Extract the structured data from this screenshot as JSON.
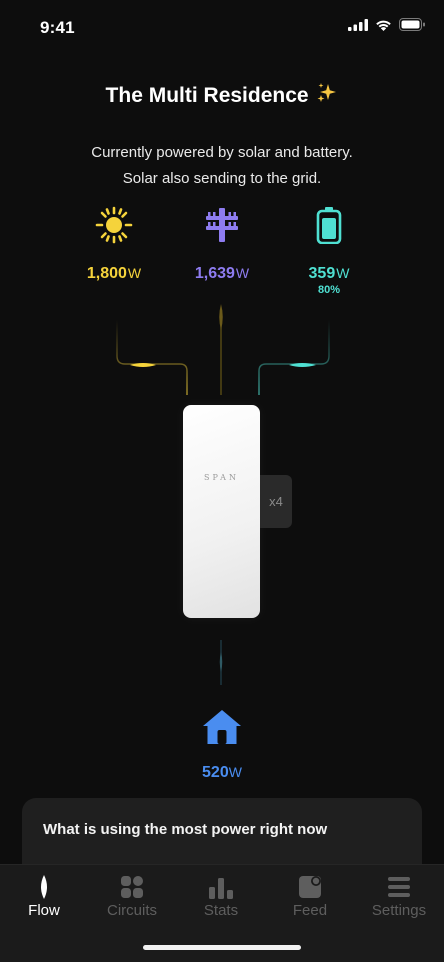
{
  "status_bar": {
    "time": "9:41"
  },
  "header": {
    "title": "The Multi Residence"
  },
  "status_text": {
    "line1": "Currently powered by solar and battery.",
    "line2": "Solar also sending to the grid."
  },
  "sources": {
    "solar": {
      "value": "1,800",
      "unit": "W",
      "color": "#f5d33b",
      "icon": "sun-icon"
    },
    "grid": {
      "value": "1,639",
      "unit": "W",
      "color": "#8e7cf0",
      "icon": "utility-pole-icon"
    },
    "battery": {
      "value": "359",
      "unit": "W",
      "percent": "80%",
      "color": "#4fe0d2",
      "icon": "battery-icon"
    }
  },
  "panel": {
    "brand": "SPAN",
    "count_badge": "x4"
  },
  "home": {
    "value": "520",
    "unit": "W",
    "color": "#4a8df0",
    "icon": "house-icon"
  },
  "card": {
    "title": "What is using the most power right now"
  },
  "tabs": [
    {
      "label": "Flow",
      "icon": "flow-icon",
      "active": true
    },
    {
      "label": "Circuits",
      "icon": "circuits-icon",
      "active": false
    },
    {
      "label": "Stats",
      "icon": "stats-icon",
      "active": false
    },
    {
      "label": "Feed",
      "icon": "feed-icon",
      "active": false
    },
    {
      "label": "Settings",
      "icon": "settings-icon",
      "active": false
    }
  ]
}
